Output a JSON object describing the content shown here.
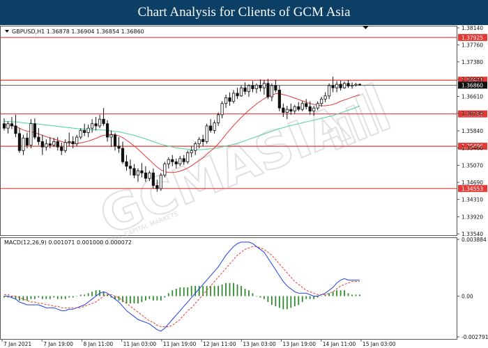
{
  "title": "Chart Analysis for Clients of GCM Asia",
  "colors": {
    "title_bg": "#0b3f65",
    "candle": "#111111",
    "bull_fill": "#ffffff",
    "bear_fill": "#111111",
    "ma_fast": "#e53935",
    "ma_slow": "#48d39a",
    "macd_line": "#1c3ee8",
    "signal_line": "#e53935",
    "histogram": "#2e8b2e",
    "level_line": "#e53935",
    "level_label_bg": "#e53935",
    "current_label_bg": "#111111"
  },
  "watermark": {
    "brand": "GCMASIA",
    "sub": "GLOBAL CAPITAL MARKETS"
  },
  "chart_data": [
    {
      "type": "candlestick",
      "header": "GBPUSD,H1  1.36878 1.36904 1.36854 1.36860",
      "ylim": [
        1.3354,
        1.3814
      ],
      "y_ticks": [
        "1.38140",
        "1.37760",
        "1.37380",
        "1.36990",
        "1.36610",
        "1.36230",
        "1.35840",
        "1.35460",
        "1.35070",
        "1.34690",
        "1.34310",
        "1.33920",
        "1.33540"
      ],
      "x_ticks": [
        "7 Jan 2021",
        "7 Jan 19:00",
        "8 Jan 11:00",
        "11 Jan 03:00",
        "11 Jan 19:00",
        "12 Jan 11:00",
        "13 Jan 03:00",
        "13 Jan 19:00",
        "14 Jan 11:00",
        "15 Jan 03:00"
      ],
      "levels": [
        {
          "value": 1.37925,
          "label": "1.37925"
        },
        {
          "value": 1.36971,
          "label": "1.36971"
        },
        {
          "value": 1.36218,
          "label": "1.36218"
        },
        {
          "value": 1.35496,
          "label": "1.35496"
        },
        {
          "value": 1.34553,
          "label": "1.34553"
        }
      ],
      "current": {
        "value": 1.3686,
        "label": "1.36860"
      },
      "candles": [
        [
          1.36,
          1.3612,
          1.3585,
          1.359
        ],
        [
          1.359,
          1.3605,
          1.3578,
          1.36
        ],
        [
          1.36,
          1.3615,
          1.3588,
          1.3595
        ],
        [
          1.3595,
          1.362,
          1.357,
          1.3578
        ],
        [
          1.3578,
          1.359,
          1.3535,
          1.354
        ],
        [
          1.354,
          1.3575,
          1.353,
          1.3568
        ],
        [
          1.3568,
          1.358,
          1.3545,
          1.3552
        ],
        [
          1.3552,
          1.361,
          1.3545,
          1.36
        ],
        [
          1.36,
          1.3612,
          1.3565,
          1.357
        ],
        [
          1.357,
          1.359,
          1.3552,
          1.356
        ],
        [
          1.356,
          1.3575,
          1.353,
          1.3548
        ],
        [
          1.3548,
          1.3565,
          1.354,
          1.3555
        ],
        [
          1.3555,
          1.357,
          1.3545,
          1.3552
        ],
        [
          1.3552,
          1.3568,
          1.3548,
          1.356
        ],
        [
          1.356,
          1.357,
          1.354,
          1.3548
        ],
        [
          1.3548,
          1.3558,
          1.353,
          1.354
        ],
        [
          1.354,
          1.3565,
          1.3535,
          1.3558
        ],
        [
          1.3558,
          1.358,
          1.355,
          1.356
        ],
        [
          1.356,
          1.3572,
          1.3545,
          1.3555
        ],
        [
          1.3555,
          1.3575,
          1.355,
          1.357
        ],
        [
          1.357,
          1.359,
          1.3565,
          1.3585
        ],
        [
          1.3585,
          1.36,
          1.3572,
          1.358
        ],
        [
          1.358,
          1.3598,
          1.357,
          1.359
        ],
        [
          1.359,
          1.361,
          1.358,
          1.36
        ],
        [
          1.36,
          1.3615,
          1.3585,
          1.3595
        ],
        [
          1.3595,
          1.362,
          1.359,
          1.361
        ],
        [
          1.361,
          1.3635,
          1.3595,
          1.36
        ],
        [
          1.36,
          1.3608,
          1.356,
          1.357
        ],
        [
          1.357,
          1.3585,
          1.3548,
          1.3575
        ],
        [
          1.3575,
          1.358,
          1.354,
          1.355
        ],
        [
          1.355,
          1.357,
          1.3535,
          1.3545
        ],
        [
          1.3545,
          1.356,
          1.351,
          1.3515
        ],
        [
          1.3515,
          1.353,
          1.3495,
          1.3505
        ],
        [
          1.3505,
          1.352,
          1.3485,
          1.35
        ],
        [
          1.35,
          1.351,
          1.3478,
          1.3485
        ],
        [
          1.3485,
          1.35,
          1.347,
          1.3495
        ],
        [
          1.3495,
          1.3512,
          1.348,
          1.349
        ],
        [
          1.349,
          1.3505,
          1.347,
          1.3478
        ],
        [
          1.3478,
          1.3495,
          1.3472,
          1.349
        ],
        [
          1.349,
          1.35,
          1.3455,
          1.3462
        ],
        [
          1.3462,
          1.3475,
          1.3448,
          1.3455
        ],
        [
          1.3455,
          1.349,
          1.345,
          1.3485
        ],
        [
          1.3485,
          1.3515,
          1.348,
          1.351
        ],
        [
          1.351,
          1.3525,
          1.35,
          1.352
        ],
        [
          1.352,
          1.353,
          1.3505,
          1.3515
        ],
        [
          1.3515,
          1.3522,
          1.35,
          1.351
        ],
        [
          1.351,
          1.3528,
          1.3505,
          1.3522
        ],
        [
          1.3522,
          1.353,
          1.3508,
          1.3515
        ],
        [
          1.3515,
          1.354,
          1.351,
          1.3535
        ],
        [
          1.3535,
          1.355,
          1.3525,
          1.354
        ],
        [
          1.354,
          1.356,
          1.353,
          1.3555
        ],
        [
          1.3555,
          1.357,
          1.3545,
          1.3565
        ],
        [
          1.3565,
          1.3575,
          1.355,
          1.356
        ],
        [
          1.356,
          1.36,
          1.3555,
          1.3595
        ],
        [
          1.3595,
          1.361,
          1.358,
          1.3585
        ],
        [
          1.3585,
          1.3608,
          1.3578,
          1.3602
        ],
        [
          1.3602,
          1.3625,
          1.3595,
          1.362
        ],
        [
          1.362,
          1.365,
          1.3612,
          1.3645
        ],
        [
          1.3645,
          1.3665,
          1.3635,
          1.3658
        ],
        [
          1.3658,
          1.367,
          1.364,
          1.365
        ],
        [
          1.365,
          1.3675,
          1.3645,
          1.3668
        ],
        [
          1.3668,
          1.368,
          1.3655,
          1.3662
        ],
        [
          1.3662,
          1.3685,
          1.366,
          1.368
        ],
        [
          1.368,
          1.3692,
          1.3665,
          1.3672
        ],
        [
          1.3672,
          1.3688,
          1.366,
          1.3685
        ],
        [
          1.3685,
          1.3695,
          1.367,
          1.3678
        ],
        [
          1.3678,
          1.369,
          1.3668,
          1.3686
        ],
        [
          1.3686,
          1.3699,
          1.3672,
          1.368
        ],
        [
          1.368,
          1.3698,
          1.3665,
          1.369
        ],
        [
          1.369,
          1.37,
          1.3655,
          1.366
        ],
        [
          1.366,
          1.369,
          1.365,
          1.3685
        ],
        [
          1.3685,
          1.3698,
          1.367,
          1.3675
        ],
        [
          1.3675,
          1.3685,
          1.3628,
          1.3635
        ],
        [
          1.3635,
          1.3645,
          1.3615,
          1.3625
        ],
        [
          1.3625,
          1.364,
          1.361,
          1.3632
        ],
        [
          1.3632,
          1.3645,
          1.362,
          1.3628
        ],
        [
          1.3628,
          1.3642,
          1.3622,
          1.3638
        ],
        [
          1.3638,
          1.3648,
          1.3628,
          1.3632
        ],
        [
          1.3632,
          1.365,
          1.3628,
          1.3645
        ],
        [
          1.3645,
          1.3655,
          1.3632,
          1.3638
        ],
        [
          1.3638,
          1.365,
          1.362,
          1.3628
        ],
        [
          1.3628,
          1.364,
          1.3618,
          1.3635
        ],
        [
          1.3635,
          1.365,
          1.363,
          1.3645
        ],
        [
          1.3645,
          1.366,
          1.3638,
          1.3655
        ],
        [
          1.3655,
          1.367,
          1.3648,
          1.3662
        ],
        [
          1.3662,
          1.369,
          1.3655,
          1.3685
        ],
        [
          1.3685,
          1.3705,
          1.367,
          1.368
        ],
        [
          1.368,
          1.3695,
          1.367,
          1.3688
        ],
        [
          1.3688,
          1.3696,
          1.3674,
          1.368
        ],
        [
          1.368,
          1.3694,
          1.3678,
          1.369
        ],
        [
          1.369,
          1.3698,
          1.368,
          1.3684
        ],
        [
          1.3684,
          1.3692,
          1.3678,
          1.3686
        ],
        [
          1.3686,
          1.3691,
          1.3683,
          1.3688
        ],
        [
          1.3688,
          1.369,
          1.3685,
          1.3686
        ]
      ],
      "ma_fast": [
        1.3598,
        1.3597,
        1.3596,
        1.3594,
        1.359,
        1.3586,
        1.3583,
        1.3582,
        1.358,
        1.3577,
        1.3574,
        1.3571,
        1.3568,
        1.3566,
        1.3563,
        1.356,
        1.3558,
        1.3557,
        1.3556,
        1.3556,
        1.3557,
        1.3559,
        1.3561,
        1.3564,
        1.3567,
        1.3571,
        1.3574,
        1.3575,
        1.3576,
        1.3575,
        1.3573,
        1.3569,
        1.3563,
        1.3557,
        1.355,
        1.3543,
        1.3535,
        1.3527,
        1.3519,
        1.3511,
        1.3503,
        1.3497,
        1.3493,
        1.3491,
        1.3491,
        1.3492,
        1.3494,
        1.3497,
        1.3501,
        1.3506,
        1.3512,
        1.3518,
        1.3524,
        1.3532,
        1.3539,
        1.3546,
        1.3555,
        1.3565,
        1.3576,
        1.3586,
        1.3596,
        1.3605,
        1.3614,
        1.3622,
        1.363,
        1.3637,
        1.3644,
        1.365,
        1.3656,
        1.366,
        1.3664,
        1.3667,
        1.3667,
        1.3665,
        1.3663,
        1.366,
        1.3657,
        1.3654,
        1.3651,
        1.3648,
        1.3645,
        1.3643,
        1.3641,
        1.364,
        1.364,
        1.3641,
        1.3643,
        1.3646,
        1.365,
        1.3653,
        1.3656,
        1.3659,
        1.3662,
        1.3665
      ],
      "ma_slow": [
        1.3605,
        1.3605,
        1.3604,
        1.3604,
        1.3603,
        1.3602,
        1.3601,
        1.3601,
        1.36,
        1.3599,
        1.3598,
        1.3597,
        1.3596,
        1.3595,
        1.3594,
        1.3593,
        1.3592,
        1.3591,
        1.359,
        1.3589,
        1.3588,
        1.3588,
        1.3587,
        1.3587,
        1.3586,
        1.3586,
        1.3586,
        1.3585,
        1.3584,
        1.3583,
        1.3582,
        1.358,
        1.3578,
        1.3576,
        1.3574,
        1.3571,
        1.3569,
        1.3566,
        1.3563,
        1.356,
        1.3557,
        1.3554,
        1.3552,
        1.355,
        1.3548,
        1.3546,
        1.3545,
        1.3544,
        1.3543,
        1.3542,
        1.3542,
        1.3542,
        1.3542,
        1.3543,
        1.3544,
        1.3545,
        1.3546,
        1.3548,
        1.355,
        1.3552,
        1.3554,
        1.3556,
        1.3559,
        1.3562,
        1.3565,
        1.3568,
        1.3571,
        1.3574,
        1.3577,
        1.358,
        1.3583,
        1.3586,
        1.3589,
        1.3591,
        1.3594,
        1.3596,
        1.3598,
        1.36,
        1.3602,
        1.3604,
        1.3606,
        1.3608,
        1.361,
        1.3612,
        1.3614,
        1.3616,
        1.3618,
        1.3621,
        1.3624,
        1.3627,
        1.363,
        1.3633,
        1.3636,
        1.364
      ]
    },
    {
      "type": "macd",
      "header": "MACD(12,26,9) 0.001071 0.001000 0.000072",
      "ylim": [
        -0.002791,
        0.003884
      ],
      "y_ticks": [
        "0.003884",
        "0.00",
        "-0.002791"
      ],
      "macd_line": [
        0.0,
        0.0,
        -0.0001,
        -0.0002,
        -0.0004,
        -0.0005,
        -0.0006,
        -0.0006,
        -0.0006,
        -0.0006,
        -0.0007,
        -0.0008,
        -0.0008,
        -0.0008,
        -0.0009,
        -0.001,
        -0.001,
        -0.0009,
        -0.0009,
        -0.0008,
        -0.0007,
        -0.0006,
        -0.0004,
        -0.0002,
        0.0,
        0.0002,
        0.0003,
        0.0002,
        0.0,
        -0.0002,
        -0.0004,
        -0.0007,
        -0.001,
        -0.0012,
        -0.0014,
        -0.0016,
        -0.0017,
        -0.0018,
        -0.0019,
        -0.0021,
        -0.0023,
        -0.0024,
        -0.0022,
        -0.0019,
        -0.0016,
        -0.0013,
        -0.001,
        -0.0007,
        -0.0004,
        -0.0001,
        0.0002,
        0.0005,
        0.0008,
        0.0011,
        0.0014,
        0.0017,
        0.002,
        0.0024,
        0.0028,
        0.0031,
        0.0034,
        0.0036,
        0.0037,
        0.0037,
        0.0037,
        0.0036,
        0.0034,
        0.0032,
        0.003,
        0.0026,
        0.0022,
        0.0018,
        0.0014,
        0.001,
        0.0007,
        0.0005,
        0.0003,
        0.0002,
        0.0002,
        0.0002,
        0.0001,
        0.0,
        0.0,
        0.0001,
        0.0002,
        0.0004,
        0.0006,
        0.0009,
        0.0011,
        0.0012,
        0.0011,
        0.0011,
        0.0011,
        0.0011
      ],
      "signal_line": [
        0.0001,
        0.0001,
        0.0,
        0.0,
        -0.0001,
        -0.0002,
        -0.0003,
        -0.0004,
        -0.0004,
        -0.0005,
        -0.0005,
        -0.0006,
        -0.0006,
        -0.0007,
        -0.0007,
        -0.0008,
        -0.0008,
        -0.0008,
        -0.0008,
        -0.0008,
        -0.0008,
        -0.0007,
        -0.0006,
        -0.0005,
        -0.0004,
        -0.0002,
        0.0,
        0.0001,
        0.0001,
        0.0,
        -0.0001,
        -0.0003,
        -0.0005,
        -0.0007,
        -0.0009,
        -0.0011,
        -0.0013,
        -0.0015,
        -0.0017,
        -0.0018,
        -0.002,
        -0.0021,
        -0.0021,
        -0.0021,
        -0.002,
        -0.0018,
        -0.0016,
        -0.0013,
        -0.001,
        -0.0008,
        -0.0005,
        -0.0002,
        0.0001,
        0.0004,
        0.0007,
        0.001,
        0.0013,
        0.0016,
        0.0019,
        0.0022,
        0.0025,
        0.0028,
        0.003,
        0.0032,
        0.0033,
        0.0034,
        0.0034,
        0.0033,
        0.0032,
        0.003,
        0.0028,
        0.0025,
        0.0022,
        0.0019,
        0.0016,
        0.0013,
        0.001,
        0.0008,
        0.0006,
        0.0004,
        0.0003,
        0.0002,
        0.0001,
        0.0001,
        0.0001,
        0.0002,
        0.0003,
        0.0005,
        0.0007,
        0.0008,
        0.0009,
        0.001,
        0.001,
        0.001
      ],
      "histogram": [
        -0.0001,
        -0.0001,
        -0.0001,
        -0.0002,
        -0.0003,
        -0.0003,
        -0.0003,
        -0.0002,
        -0.0002,
        -0.0001,
        -0.0002,
        -0.0002,
        -0.0002,
        -0.0001,
        -0.0002,
        -0.0002,
        -0.0002,
        -0.0001,
        -0.0001,
        0.0,
        0.0001,
        0.0001,
        0.0002,
        0.0003,
        0.0004,
        0.0004,
        0.0003,
        0.0001,
        -0.0001,
        -0.0002,
        -0.0003,
        -0.0004,
        -0.0005,
        -0.0005,
        -0.0005,
        -0.0005,
        -0.0004,
        -0.0003,
        -0.0002,
        -0.0003,
        -0.0003,
        -0.0003,
        -0.0001,
        0.0002,
        0.0004,
        0.0005,
        0.0006,
        0.0006,
        0.0006,
        0.0007,
        0.0007,
        0.0007,
        0.0007,
        0.0007,
        0.0007,
        0.0007,
        0.0007,
        0.0008,
        0.0009,
        0.0009,
        0.0009,
        0.0008,
        0.0007,
        0.0005,
        0.0004,
        0.0002,
        0.0,
        -0.0001,
        -0.0002,
        -0.0004,
        -0.0006,
        -0.0007,
        -0.0008,
        -0.0009,
        -0.0009,
        -0.0008,
        -0.0007,
        -0.0006,
        -0.0004,
        -0.0002,
        -0.0002,
        -0.0002,
        -0.0001,
        0.0,
        0.0001,
        0.0002,
        0.0003,
        0.0004,
        0.0004,
        0.0004,
        0.0002,
        0.0001,
        0.0001,
        0.0001
      ]
    }
  ]
}
